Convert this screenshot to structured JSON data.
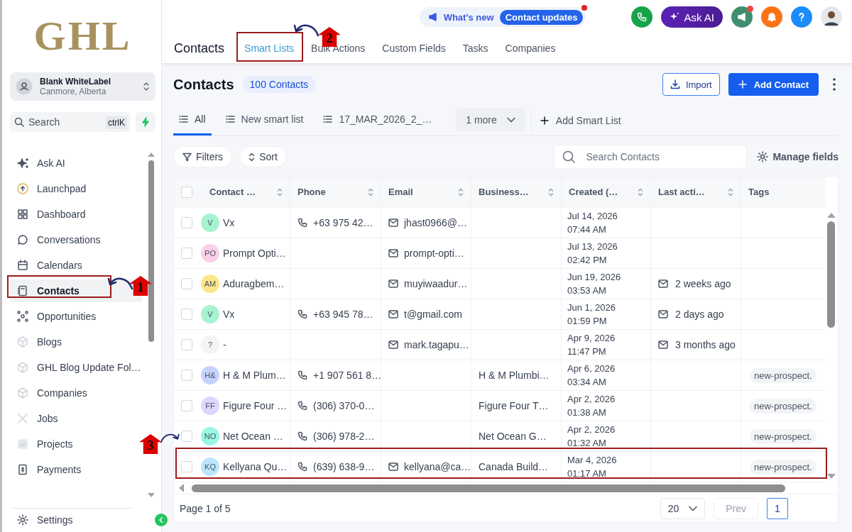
{
  "sidebar": {
    "logo": "GHL",
    "account": {
      "name": "Blank WhiteLabel",
      "location": "Canmore, Alberta"
    },
    "search": {
      "placeholder": "Search",
      "shortcut": "ctrlK"
    },
    "items": [
      {
        "label": "Ask AI",
        "selected": false
      },
      {
        "label": "Launchpad",
        "selected": false
      },
      {
        "label": "Dashboard",
        "selected": false
      },
      {
        "label": "Conversations",
        "selected": false
      },
      {
        "label": "Calendars",
        "selected": false
      },
      {
        "label": "Contacts",
        "selected": true
      },
      {
        "label": "Opportunities",
        "selected": false
      },
      {
        "label": "Blogs",
        "selected": false
      },
      {
        "label": "GHL Blog Update Fol…",
        "selected": false
      },
      {
        "label": "Companies",
        "selected": false
      },
      {
        "label": "Jobs",
        "selected": false
      },
      {
        "label": "Projects",
        "selected": false
      },
      {
        "label": "Payments",
        "selected": false
      }
    ],
    "footer": "Settings"
  },
  "header": {
    "title": "Contacts",
    "tabs": [
      {
        "label": "Smart Lists",
        "selected": true
      },
      {
        "label": "Bulk Actions",
        "selected": false
      },
      {
        "label": "Custom Fields",
        "selected": false
      },
      {
        "label": "Tasks",
        "selected": false
      },
      {
        "label": "Companies",
        "selected": false
      }
    ],
    "whats_new": {
      "label": "What's new",
      "badge": "Contact updates"
    },
    "ask_ai": "Ask AI"
  },
  "page": {
    "title": "Contacts",
    "count": "100 Contacts",
    "import": "Import",
    "add": "Add Contact"
  },
  "smart_lists": {
    "tabs": [
      {
        "label": "All",
        "selected": true
      },
      {
        "label": "New smart list",
        "selected": false
      },
      {
        "label": "17_MAR_2026_2_…",
        "selected": false
      }
    ],
    "more": "1 more",
    "add": "Add Smart List"
  },
  "toolbar": {
    "filters": "Filters",
    "sort": "Sort",
    "search_placeholder": "Search Contacts",
    "manage": "Manage fields"
  },
  "table": {
    "select_all": {
      "checked": false
    },
    "columns": [
      "Contact …",
      "Phone",
      "Email",
      "Business…",
      "Created (…",
      "Last acti…",
      "Tags"
    ],
    "rows": [
      {
        "checked": false,
        "initials": "V",
        "color": "#a7f3d0",
        "name": "Vx",
        "phone": "+63 975 42…",
        "email": "jhast0966@…",
        "business": "",
        "created_date": "Jul 14, 2026",
        "created_time": "07:44 AM",
        "last_activity": "",
        "tag": ""
      },
      {
        "checked": false,
        "initials": "PO",
        "color": "#fbcfe8",
        "name": "Prompt Opti…",
        "phone": "",
        "email": "prompt-opti…",
        "business": "",
        "created_date": "Jul 13, 2026",
        "created_time": "02:42 PM",
        "last_activity": "",
        "tag": ""
      },
      {
        "checked": false,
        "initials": "AM",
        "color": "#fde68a",
        "name": "Aduragbem…",
        "phone": "",
        "email": "muyiwaadur…",
        "business": "",
        "created_date": "Jun 19, 2026",
        "created_time": "03:53 AM",
        "last_activity": "2 weeks ago",
        "tag": ""
      },
      {
        "checked": false,
        "initials": "V",
        "color": "#a7f3d0",
        "name": "Vx",
        "phone": "+63 945 78…",
        "email": "t@gmail.com",
        "business": "",
        "created_date": "Jun 1, 2026",
        "created_time": "01:59 PM",
        "last_activity": "2 days ago",
        "tag": ""
      },
      {
        "checked": false,
        "initials": "?",
        "color": "#f3f4f6",
        "name": "-",
        "phone": "",
        "email": "mark.tagapu…",
        "business": "",
        "created_date": "Apr 9, 2026",
        "created_time": "11:47 PM",
        "last_activity": "3 months ago",
        "tag": ""
      },
      {
        "checked": false,
        "initials": "H&",
        "color": "#c7d2fe",
        "name": "H & M Plum…",
        "phone": "+1 907 561 8…",
        "email": "",
        "business": "H & M Plumbi…",
        "created_date": "Apr 6, 2026",
        "created_time": "03:34 AM",
        "last_activity": "",
        "tag": "new-prospect."
      },
      {
        "checked": false,
        "initials": "FF",
        "color": "#ddd6fe",
        "name": "Figure Four …",
        "phone": "(306) 370-0…",
        "email": "",
        "business": "Figure Four T…",
        "created_date": "Apr 2, 2026",
        "created_time": "01:38 AM",
        "last_activity": "",
        "tag": "new-prospect."
      },
      {
        "checked": false,
        "initials": "NO",
        "color": "#99f6e4",
        "name": "Net Ocean …",
        "phone": "(306) 978-2…",
        "email": "",
        "business": "Net Ocean G…",
        "created_date": "Apr 2, 2026",
        "created_time": "01:32 AM",
        "last_activity": "",
        "tag": "new-prospect."
      },
      {
        "checked": false,
        "initials": "KQ",
        "color": "#bae6fd",
        "name": "Kellyana Qu…",
        "phone": "(639) 638-9…",
        "email": "kellyana@ca…",
        "business": "Canada Build…",
        "created_date": "Mar 4, 2026",
        "created_time": "01:17 AM",
        "last_activity": "",
        "tag": "new-prospect."
      }
    ]
  },
  "pagination": {
    "label": "Page 1 of 5",
    "per_page": "20",
    "prev": "Prev",
    "page": "1"
  },
  "annotations": [
    {
      "number": "1"
    },
    {
      "number": "2"
    },
    {
      "number": "3"
    }
  ]
}
